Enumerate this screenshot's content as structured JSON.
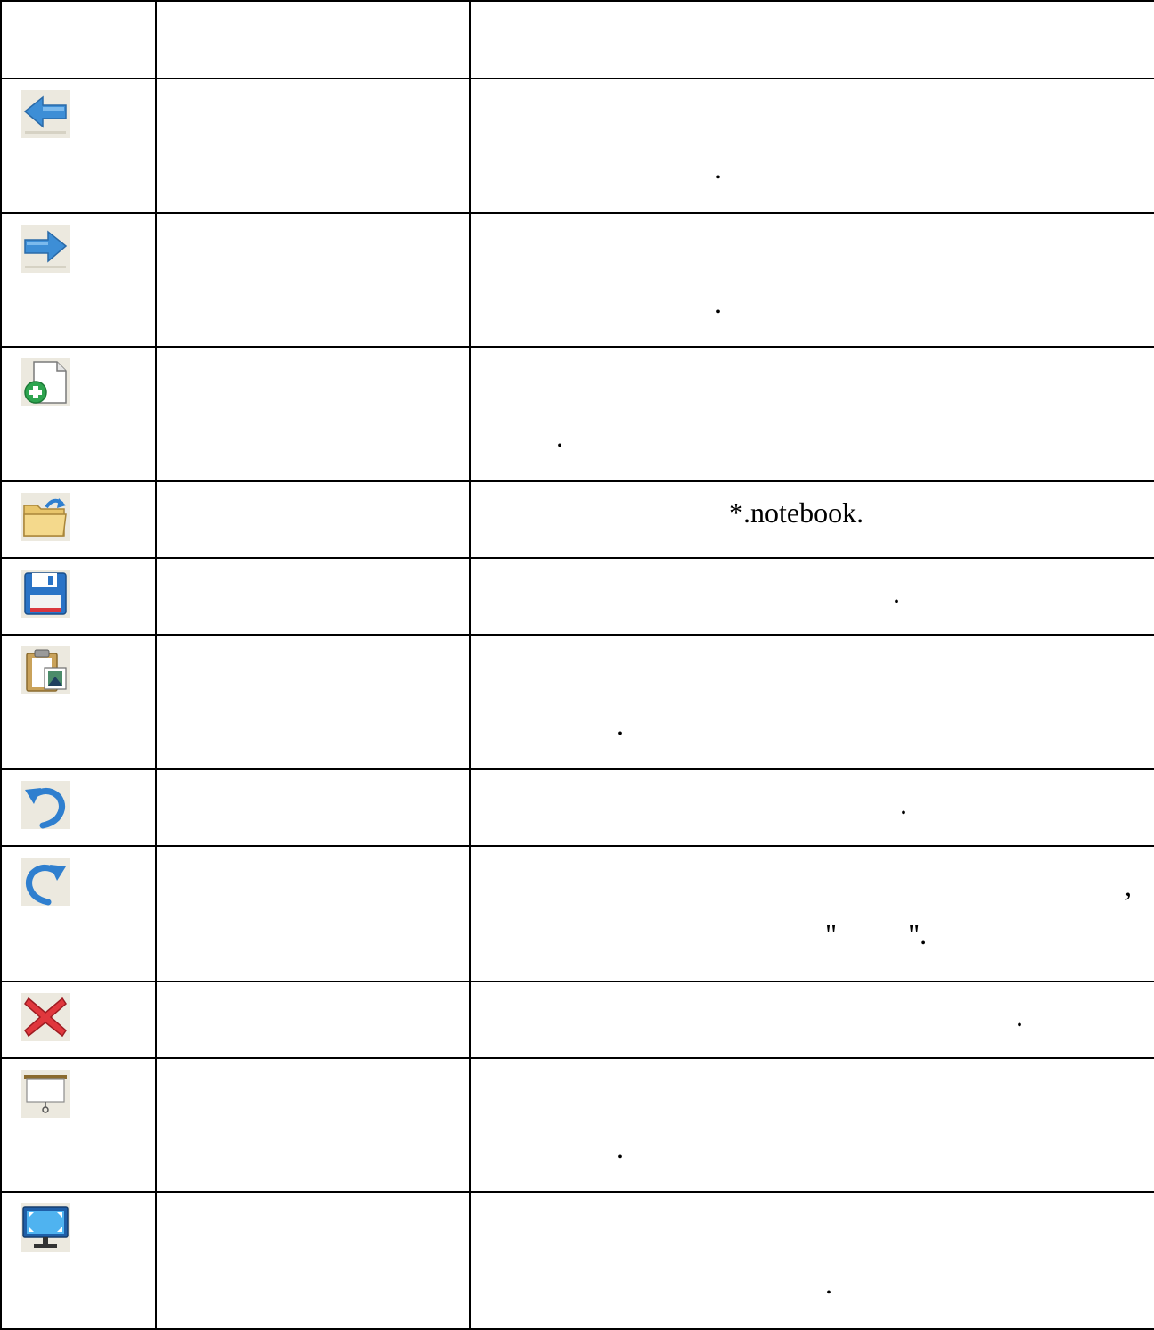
{
  "table": {
    "header": [
      "",
      "",
      ""
    ],
    "rows": [
      {
        "icon": "back-arrow-icon",
        "name": "",
        "description_line1": "",
        "description_line2": "."
      },
      {
        "icon": "forward-arrow-icon",
        "name": "",
        "description_line1": "",
        "description_line2": "."
      },
      {
        "icon": "add-page-icon",
        "name": "",
        "description_line1": "",
        "description_line2": "."
      },
      {
        "icon": "open-folder-icon",
        "name": "",
        "description_line1": "*.notebook.",
        "description_line2": ""
      },
      {
        "icon": "save-floppy-icon",
        "name": "",
        "description_line1": ".",
        "description_line2": ""
      },
      {
        "icon": "paste-clipboard-icon",
        "name": "",
        "description_line1": "",
        "description_line2": "."
      },
      {
        "icon": "undo-icon",
        "name": "",
        "description_line1": ".",
        "description_line2": ""
      },
      {
        "icon": "redo-icon",
        "name": "",
        "description_line1": ",",
        "description_line2": "\"          \"."
      },
      {
        "icon": "delete-x-icon",
        "name": "",
        "description_line1": ".",
        "description_line2": ""
      },
      {
        "icon": "screen-shade-icon",
        "name": "",
        "description_line1": "",
        "description_line2": "."
      },
      {
        "icon": "full-screen-monitor-icon",
        "name": "",
        "description_line1": "",
        "description_line2": "."
      }
    ]
  }
}
